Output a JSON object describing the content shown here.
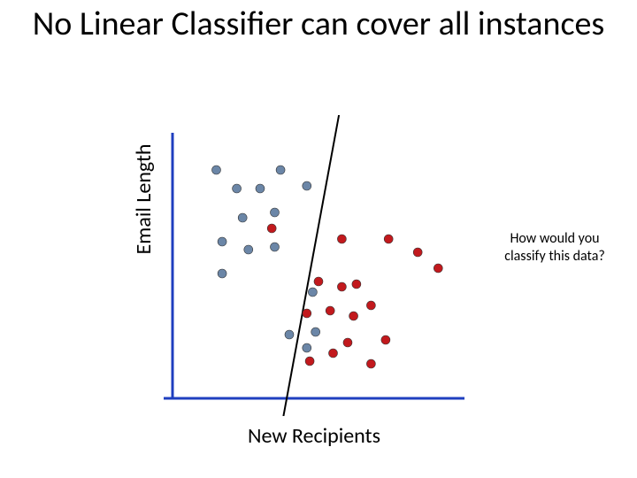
{
  "title": "No Linear Classifier can cover all instances",
  "side_note": "How would you classify this data?",
  "chart_data": {
    "type": "scatter",
    "xlabel": "New Recipients",
    "ylabel": "Email Length",
    "xlim": [
      0,
      100
    ],
    "ylim": [
      0,
      100
    ],
    "grid": false,
    "legend": false,
    "series": [
      {
        "name": "blue-grey",
        "color": "#6b86a7",
        "points": [
          {
            "x": 15,
            "y": 86
          },
          {
            "x": 22,
            "y": 79
          },
          {
            "x": 30,
            "y": 79
          },
          {
            "x": 37,
            "y": 86
          },
          {
            "x": 46,
            "y": 80
          },
          {
            "x": 24,
            "y": 68
          },
          {
            "x": 35,
            "y": 70
          },
          {
            "x": 17,
            "y": 59
          },
          {
            "x": 26,
            "y": 56
          },
          {
            "x": 35,
            "y": 57
          },
          {
            "x": 17,
            "y": 47
          },
          {
            "x": 48,
            "y": 40
          },
          {
            "x": 40,
            "y": 24
          },
          {
            "x": 46,
            "y": 19
          },
          {
            "x": 49,
            "y": 25
          }
        ]
      },
      {
        "name": "red",
        "color": "#c2191d",
        "points": [
          {
            "x": 34,
            "y": 64
          },
          {
            "x": 58,
            "y": 60
          },
          {
            "x": 74,
            "y": 60
          },
          {
            "x": 84,
            "y": 55
          },
          {
            "x": 91,
            "y": 49
          },
          {
            "x": 50,
            "y": 44
          },
          {
            "x": 58,
            "y": 42
          },
          {
            "x": 63,
            "y": 43
          },
          {
            "x": 54,
            "y": 33
          },
          {
            "x": 46,
            "y": 32
          },
          {
            "x": 62,
            "y": 31
          },
          {
            "x": 68,
            "y": 35
          },
          {
            "x": 60,
            "y": 21
          },
          {
            "x": 73,
            "y": 22
          },
          {
            "x": 55,
            "y": 17
          },
          {
            "x": 47,
            "y": 14
          },
          {
            "x": 68,
            "y": 13
          }
        ]
      }
    ],
    "separator_line": {
      "x1": 38,
      "y1": 0,
      "x2": 57,
      "y2": 100
    }
  }
}
